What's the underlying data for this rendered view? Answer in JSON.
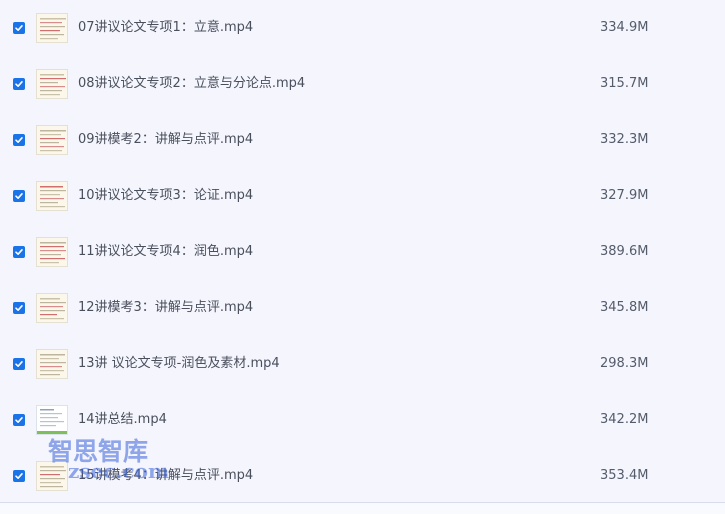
{
  "files": [
    {
      "name": "07讲议论文专项1：立意.mp4",
      "size": "334.9M",
      "checked": true,
      "thumb_icon": "video-thumbnail-icon"
    },
    {
      "name": "08讲议论文专项2：立意与分论点.mp4",
      "size": "315.7M",
      "checked": true,
      "thumb_icon": "video-thumbnail-icon"
    },
    {
      "name": "09讲模考2：讲解与点评.mp4",
      "size": "332.3M",
      "checked": true,
      "thumb_icon": "video-thumbnail-icon"
    },
    {
      "name": "10讲议论文专项3：论证.mp4",
      "size": "327.9M",
      "checked": true,
      "thumb_icon": "video-thumbnail-icon"
    },
    {
      "name": "11讲议论文专项4：润色.mp4",
      "size": "389.6M",
      "checked": true,
      "thumb_icon": "video-thumbnail-icon"
    },
    {
      "name": "12讲模考3：讲解与点评.mp4",
      "size": "345.8M",
      "checked": true,
      "thumb_icon": "video-thumbnail-icon"
    },
    {
      "name": "13讲 议论文专项-润色及素材.mp4",
      "size": "298.3M",
      "checked": true,
      "thumb_icon": "video-thumbnail-icon"
    },
    {
      "name": "14讲总结.mp4",
      "size": "342.2M",
      "checked": true,
      "thumb_icon": "video-thumbnail-icon"
    },
    {
      "name": "15讲模考4：讲解与点评.mp4",
      "size": "353.4M",
      "checked": true,
      "thumb_icon": "video-thumbnail-icon"
    }
  ],
  "watermark": {
    "line1": "智思智库",
    "line2": "zsec.com"
  },
  "colors": {
    "background": "#f5f6fd",
    "checkbox": "#1a73e8",
    "text": "#4a4f5c",
    "watermark": "#3b62d8"
  }
}
